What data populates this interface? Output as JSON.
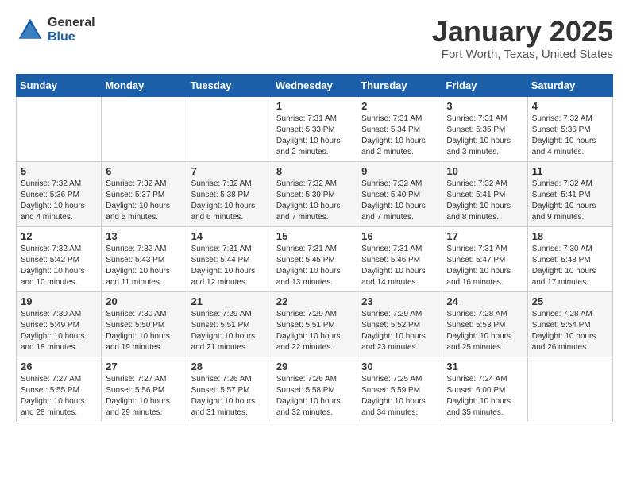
{
  "header": {
    "logo_general": "General",
    "logo_blue": "Blue",
    "month_title": "January 2025",
    "location": "Fort Worth, Texas, United States"
  },
  "days_of_week": [
    "Sunday",
    "Monday",
    "Tuesday",
    "Wednesday",
    "Thursday",
    "Friday",
    "Saturday"
  ],
  "weeks": [
    [
      {
        "day": "",
        "sunrise": "",
        "sunset": "",
        "daylight": ""
      },
      {
        "day": "",
        "sunrise": "",
        "sunset": "",
        "daylight": ""
      },
      {
        "day": "",
        "sunrise": "",
        "sunset": "",
        "daylight": ""
      },
      {
        "day": "1",
        "sunrise": "Sunrise: 7:31 AM",
        "sunset": "Sunset: 5:33 PM",
        "daylight": "Daylight: 10 hours and 2 minutes."
      },
      {
        "day": "2",
        "sunrise": "Sunrise: 7:31 AM",
        "sunset": "Sunset: 5:34 PM",
        "daylight": "Daylight: 10 hours and 2 minutes."
      },
      {
        "day": "3",
        "sunrise": "Sunrise: 7:31 AM",
        "sunset": "Sunset: 5:35 PM",
        "daylight": "Daylight: 10 hours and 3 minutes."
      },
      {
        "day": "4",
        "sunrise": "Sunrise: 7:32 AM",
        "sunset": "Sunset: 5:36 PM",
        "daylight": "Daylight: 10 hours and 4 minutes."
      }
    ],
    [
      {
        "day": "5",
        "sunrise": "Sunrise: 7:32 AM",
        "sunset": "Sunset: 5:36 PM",
        "daylight": "Daylight: 10 hours and 4 minutes."
      },
      {
        "day": "6",
        "sunrise": "Sunrise: 7:32 AM",
        "sunset": "Sunset: 5:37 PM",
        "daylight": "Daylight: 10 hours and 5 minutes."
      },
      {
        "day": "7",
        "sunrise": "Sunrise: 7:32 AM",
        "sunset": "Sunset: 5:38 PM",
        "daylight": "Daylight: 10 hours and 6 minutes."
      },
      {
        "day": "8",
        "sunrise": "Sunrise: 7:32 AM",
        "sunset": "Sunset: 5:39 PM",
        "daylight": "Daylight: 10 hours and 7 minutes."
      },
      {
        "day": "9",
        "sunrise": "Sunrise: 7:32 AM",
        "sunset": "Sunset: 5:40 PM",
        "daylight": "Daylight: 10 hours and 7 minutes."
      },
      {
        "day": "10",
        "sunrise": "Sunrise: 7:32 AM",
        "sunset": "Sunset: 5:41 PM",
        "daylight": "Daylight: 10 hours and 8 minutes."
      },
      {
        "day": "11",
        "sunrise": "Sunrise: 7:32 AM",
        "sunset": "Sunset: 5:41 PM",
        "daylight": "Daylight: 10 hours and 9 minutes."
      }
    ],
    [
      {
        "day": "12",
        "sunrise": "Sunrise: 7:32 AM",
        "sunset": "Sunset: 5:42 PM",
        "daylight": "Daylight: 10 hours and 10 minutes."
      },
      {
        "day": "13",
        "sunrise": "Sunrise: 7:32 AM",
        "sunset": "Sunset: 5:43 PM",
        "daylight": "Daylight: 10 hours and 11 minutes."
      },
      {
        "day": "14",
        "sunrise": "Sunrise: 7:31 AM",
        "sunset": "Sunset: 5:44 PM",
        "daylight": "Daylight: 10 hours and 12 minutes."
      },
      {
        "day": "15",
        "sunrise": "Sunrise: 7:31 AM",
        "sunset": "Sunset: 5:45 PM",
        "daylight": "Daylight: 10 hours and 13 minutes."
      },
      {
        "day": "16",
        "sunrise": "Sunrise: 7:31 AM",
        "sunset": "Sunset: 5:46 PM",
        "daylight": "Daylight: 10 hours and 14 minutes."
      },
      {
        "day": "17",
        "sunrise": "Sunrise: 7:31 AM",
        "sunset": "Sunset: 5:47 PM",
        "daylight": "Daylight: 10 hours and 16 minutes."
      },
      {
        "day": "18",
        "sunrise": "Sunrise: 7:30 AM",
        "sunset": "Sunset: 5:48 PM",
        "daylight": "Daylight: 10 hours and 17 minutes."
      }
    ],
    [
      {
        "day": "19",
        "sunrise": "Sunrise: 7:30 AM",
        "sunset": "Sunset: 5:49 PM",
        "daylight": "Daylight: 10 hours and 18 minutes."
      },
      {
        "day": "20",
        "sunrise": "Sunrise: 7:30 AM",
        "sunset": "Sunset: 5:50 PM",
        "daylight": "Daylight: 10 hours and 19 minutes."
      },
      {
        "day": "21",
        "sunrise": "Sunrise: 7:29 AM",
        "sunset": "Sunset: 5:51 PM",
        "daylight": "Daylight: 10 hours and 21 minutes."
      },
      {
        "day": "22",
        "sunrise": "Sunrise: 7:29 AM",
        "sunset": "Sunset: 5:51 PM",
        "daylight": "Daylight: 10 hours and 22 minutes."
      },
      {
        "day": "23",
        "sunrise": "Sunrise: 7:29 AM",
        "sunset": "Sunset: 5:52 PM",
        "daylight": "Daylight: 10 hours and 23 minutes."
      },
      {
        "day": "24",
        "sunrise": "Sunrise: 7:28 AM",
        "sunset": "Sunset: 5:53 PM",
        "daylight": "Daylight: 10 hours and 25 minutes."
      },
      {
        "day": "25",
        "sunrise": "Sunrise: 7:28 AM",
        "sunset": "Sunset: 5:54 PM",
        "daylight": "Daylight: 10 hours and 26 minutes."
      }
    ],
    [
      {
        "day": "26",
        "sunrise": "Sunrise: 7:27 AM",
        "sunset": "Sunset: 5:55 PM",
        "daylight": "Daylight: 10 hours and 28 minutes."
      },
      {
        "day": "27",
        "sunrise": "Sunrise: 7:27 AM",
        "sunset": "Sunset: 5:56 PM",
        "daylight": "Daylight: 10 hours and 29 minutes."
      },
      {
        "day": "28",
        "sunrise": "Sunrise: 7:26 AM",
        "sunset": "Sunset: 5:57 PM",
        "daylight": "Daylight: 10 hours and 31 minutes."
      },
      {
        "day": "29",
        "sunrise": "Sunrise: 7:26 AM",
        "sunset": "Sunset: 5:58 PM",
        "daylight": "Daylight: 10 hours and 32 minutes."
      },
      {
        "day": "30",
        "sunrise": "Sunrise: 7:25 AM",
        "sunset": "Sunset: 5:59 PM",
        "daylight": "Daylight: 10 hours and 34 minutes."
      },
      {
        "day": "31",
        "sunrise": "Sunrise: 7:24 AM",
        "sunset": "Sunset: 6:00 PM",
        "daylight": "Daylight: 10 hours and 35 minutes."
      },
      {
        "day": "",
        "sunrise": "",
        "sunset": "",
        "daylight": ""
      }
    ]
  ]
}
